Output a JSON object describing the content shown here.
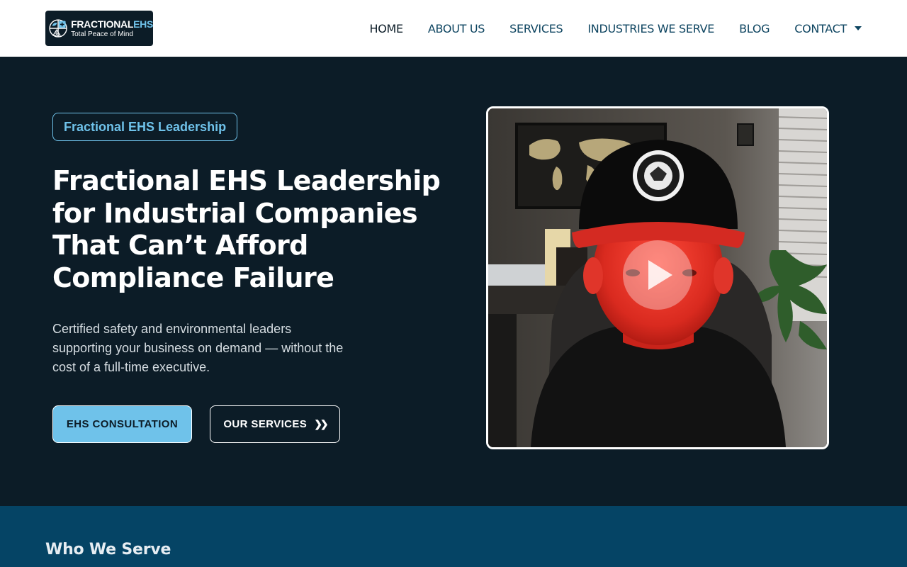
{
  "brand": {
    "name_main": "FRACTIONAL",
    "name_accent": "EHS",
    "tagline": "Total Peace of Mind",
    "icon": "logo-mark-icon"
  },
  "nav": {
    "items": [
      {
        "label": "HOME",
        "active": true
      },
      {
        "label": "ABOUT US",
        "active": false
      },
      {
        "label": "SERVICES",
        "active": false
      },
      {
        "label": "INDUSTRIES WE SERVE",
        "active": false
      },
      {
        "label": "BLOG",
        "active": false
      },
      {
        "label": "CONTACT",
        "active": false,
        "dropdown": true
      }
    ]
  },
  "hero": {
    "badge": "Fractional EHS Leadership",
    "title": "Fractional EHS Leadership for Industrial Companies That Can’t Afford Compliance Failure",
    "subtitle": "Certified safety and environmental leaders supporting your business on demand — without the cost of a full-time executive.",
    "primary_button": "EHS CONSULTATION",
    "secondary_button": "OUR SERVICES",
    "secondary_icon": "double-chevron-right-icon"
  },
  "video": {
    "play_icon": "play-icon"
  },
  "serve": {
    "title": "Who We Serve"
  },
  "colors": {
    "dark_bg": "#0c1c27",
    "accent": "#6fc2ea",
    "nav_text": "#0d4460",
    "section_bg": "#054465"
  }
}
